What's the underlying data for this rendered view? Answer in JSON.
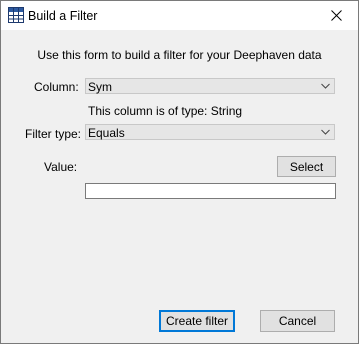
{
  "window": {
    "title": "Build a Filter"
  },
  "form": {
    "intro": "Use this form to build a filter for your Deephaven data",
    "column_label": "Column:",
    "column_value": "Sym",
    "type_note": "This column is of type: String",
    "filter_type_label": "Filter type:",
    "filter_type_value": "Equals",
    "value_label": "Value:",
    "select_button": "Select",
    "value_input": ""
  },
  "footer": {
    "create_button": "Create filter",
    "cancel_button": "Cancel"
  },
  "icons": {
    "app": "table-grid-icon",
    "close": "close-icon",
    "dropdown": "chevron-down-icon"
  }
}
